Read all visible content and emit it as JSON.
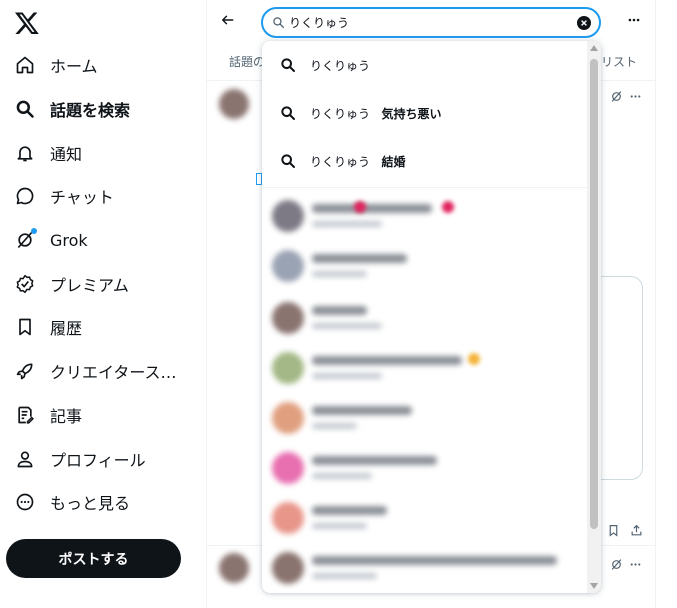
{
  "nav": {
    "items": [
      {
        "label": "ホーム",
        "icon": "home-icon"
      },
      {
        "label": "話題を検索",
        "icon": "search-icon"
      },
      {
        "label": "通知",
        "icon": "bell-icon"
      },
      {
        "label": "チャット",
        "icon": "chat-icon"
      },
      {
        "label": "Grok",
        "icon": "grok-icon"
      },
      {
        "label": "プレミアム",
        "icon": "verified-icon"
      },
      {
        "label": "履歴",
        "icon": "bookmark-icon"
      },
      {
        "label": "クリエイタース…",
        "icon": "rocket-icon"
      },
      {
        "label": "記事",
        "icon": "article-icon"
      },
      {
        "label": "プロフィール",
        "icon": "profile-icon"
      },
      {
        "label": "もっと見る",
        "icon": "more-circle-icon"
      }
    ],
    "post_button": "ポストする"
  },
  "search": {
    "value": "りくりゅう"
  },
  "tabs": {
    "left_partial": "話題の",
    "right_partial": "リスト"
  },
  "suggestions": [
    {
      "text": "りくりゅう",
      "bold": ""
    },
    {
      "text": "りくりゅう",
      "bold": "気持ち悪い"
    },
    {
      "text": "りくりゅう",
      "bold": "結婚"
    }
  ],
  "colors": {
    "accent": "#1d9bf0",
    "text": "#0f1419",
    "muted": "#536471",
    "post_button": "#0f1419"
  }
}
